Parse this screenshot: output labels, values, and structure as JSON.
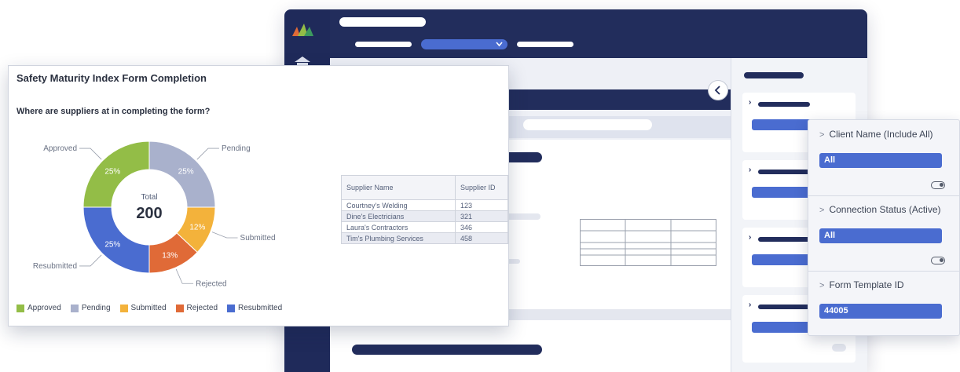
{
  "report": {
    "title": "Safety Maturity Index Form Completion",
    "question": "Where are suppliers at in completing the form?",
    "total_label": "Total",
    "total_value": "200"
  },
  "chart_data": {
    "type": "pie",
    "title": "Safety Maturity Index Form Completion",
    "subtitle": "Where are suppliers at in completing the form?",
    "center_label": "Total",
    "center_value": 200,
    "categories": [
      "Pending",
      "Submitted",
      "Rejected",
      "Resubmitted",
      "Approved"
    ],
    "values": [
      25,
      12,
      13,
      25,
      25
    ],
    "value_labels": [
      "25%",
      "12%",
      "13%",
      "25%",
      "25%"
    ],
    "colors": [
      "#a9b1cc",
      "#f3b23b",
      "#e06a37",
      "#4a6cd0",
      "#93bd47"
    ],
    "legend": [
      "Approved",
      "Pending",
      "Submitted",
      "Rejected",
      "Resubmitted"
    ],
    "legend_colors": [
      "#93bd47",
      "#a9b1cc",
      "#f3b23b",
      "#e06a37",
      "#4a6cd0"
    ],
    "legend_position": "bottom"
  },
  "suppliers": {
    "headers": [
      "Supplier Name",
      "Supplier ID"
    ],
    "rows": [
      [
        "Courtney's Welding",
        "123"
      ],
      [
        "Dine's Electricians",
        "321"
      ],
      [
        "Laura's Contractors",
        "346"
      ],
      [
        "Tim's Plumbing Services",
        "458"
      ]
    ]
  },
  "filters": [
    {
      "label": "Client Name (Include All)",
      "value": "All"
    },
    {
      "label": "Connection Status (Active)",
      "value": "All"
    },
    {
      "label": "Form Template ID",
      "value": "44005"
    }
  ],
  "colors": {
    "navy": "#1f2a5a",
    "accent_blue": "#4a6cd0",
    "panel_bg": "#eef0f6"
  }
}
